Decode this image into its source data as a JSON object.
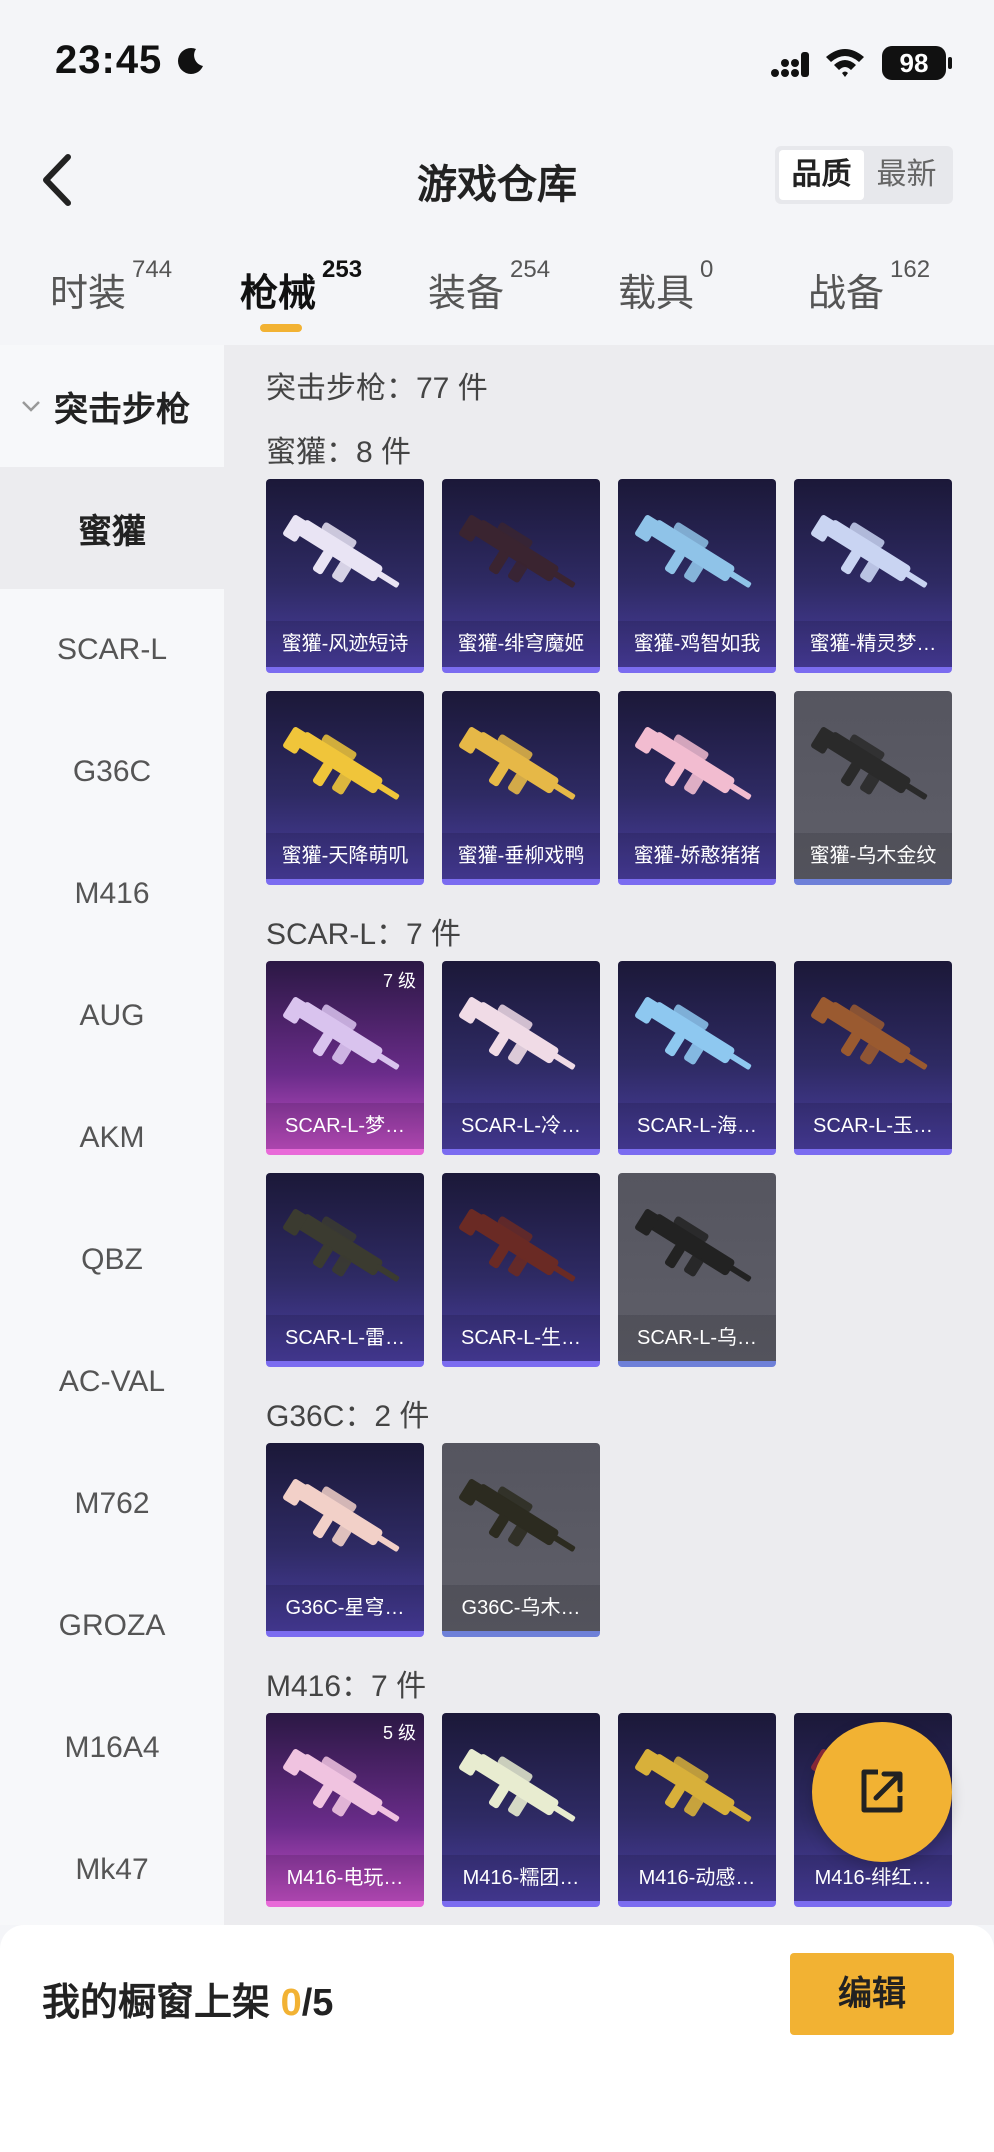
{
  "status": {
    "time": "23:45",
    "battery": "98"
  },
  "nav": {
    "title": "游戏仓库",
    "sort": [
      "品质",
      "最新"
    ]
  },
  "tabs": [
    {
      "label": "时装",
      "count": "744"
    },
    {
      "label": "枪械",
      "count": "253"
    },
    {
      "label": "装备",
      "count": "254"
    },
    {
      "label": "载具",
      "count": "0"
    },
    {
      "label": "战备",
      "count": "162"
    }
  ],
  "sidebar": {
    "group": "突击步枪",
    "items": [
      "蜜獾",
      "SCAR-L",
      "G36C",
      "M416",
      "AUG",
      "AKM",
      "QBZ",
      "AC-VAL",
      "M762",
      "GROZA",
      "M16A4",
      "Mk47"
    ]
  },
  "content": {
    "category_total": "突击步枪：77 件",
    "sections": [
      {
        "title": "蜜獾：8 件",
        "items": [
          {
            "name": "蜜獾-风迹短诗",
            "style": "purple",
            "color": "#e9e4f4"
          },
          {
            "name": "蜜獾-绯穹魔姬",
            "style": "purple",
            "color": "#3a2430"
          },
          {
            "name": "蜜獾-鸡智如我",
            "style": "purple",
            "color": "#8fc3e8"
          },
          {
            "name": "蜜獾-精灵梦…",
            "style": "purple",
            "color": "#c9d4f2"
          },
          {
            "name": "蜜獾-天降萌叽",
            "style": "purple",
            "color": "#f0c53a"
          },
          {
            "name": "蜜獾-垂柳戏鸭",
            "style": "purple",
            "color": "#e6b847"
          },
          {
            "name": "蜜獾-娇憨猪猪",
            "style": "purple",
            "color": "#f2bcd0"
          },
          {
            "name": "蜜獾-乌木金纹",
            "style": "gray",
            "color": "#2a2a2a"
          }
        ]
      },
      {
        "title": "SCAR-L：7 件",
        "items": [
          {
            "name": "SCAR-L-梦…",
            "style": "pink",
            "color": "#d9c3ee",
            "level": "7 级"
          },
          {
            "name": "SCAR-L-冷…",
            "style": "purple",
            "color": "#f0dbe6"
          },
          {
            "name": "SCAR-L-海…",
            "style": "purple",
            "color": "#8ec8f0"
          },
          {
            "name": "SCAR-L-玉…",
            "style": "purple",
            "color": "#9a5a30"
          },
          {
            "name": "SCAR-L-雷…",
            "style": "purple",
            "color": "#3b3b30"
          },
          {
            "name": "SCAR-L-生…",
            "style": "purple",
            "color": "#6a2a24"
          },
          {
            "name": "SCAR-L-乌…",
            "style": "gray",
            "color": "#222222"
          }
        ]
      },
      {
        "title": "G36C：2 件",
        "items": [
          {
            "name": "G36C-星穹…",
            "style": "purple",
            "color": "#f2d0c8"
          },
          {
            "name": "G36C-乌木…",
            "style": "gray",
            "color": "#2c2b20"
          }
        ]
      },
      {
        "title": "M416：7 件",
        "items": [
          {
            "name": "M416-电玩…",
            "style": "pink",
            "color": "#f0c3e0",
            "level": "5 级"
          },
          {
            "name": "M416-糯团…",
            "style": "purple",
            "color": "#e8ecd0"
          },
          {
            "name": "M416-动感…",
            "style": "purple",
            "color": "#d8b03a"
          },
          {
            "name": "M416-绯红…",
            "style": "purple",
            "color": "#8a2a3a"
          }
        ]
      }
    ]
  },
  "footer": {
    "label": "我的橱窗上架",
    "used": "0",
    "total": "/5",
    "edit_label": "编辑"
  },
  "colors": {
    "accent": "#f2b233",
    "card_purple": "#2e2a63",
    "card_gray": "#5f5f69",
    "card_pink": "#c44fc6"
  },
  "icons": [
    "moon-icon",
    "signal-icon",
    "wifi-icon",
    "back-arrow-icon",
    "chevron-down-icon",
    "share-icon",
    "gun-icon"
  ]
}
